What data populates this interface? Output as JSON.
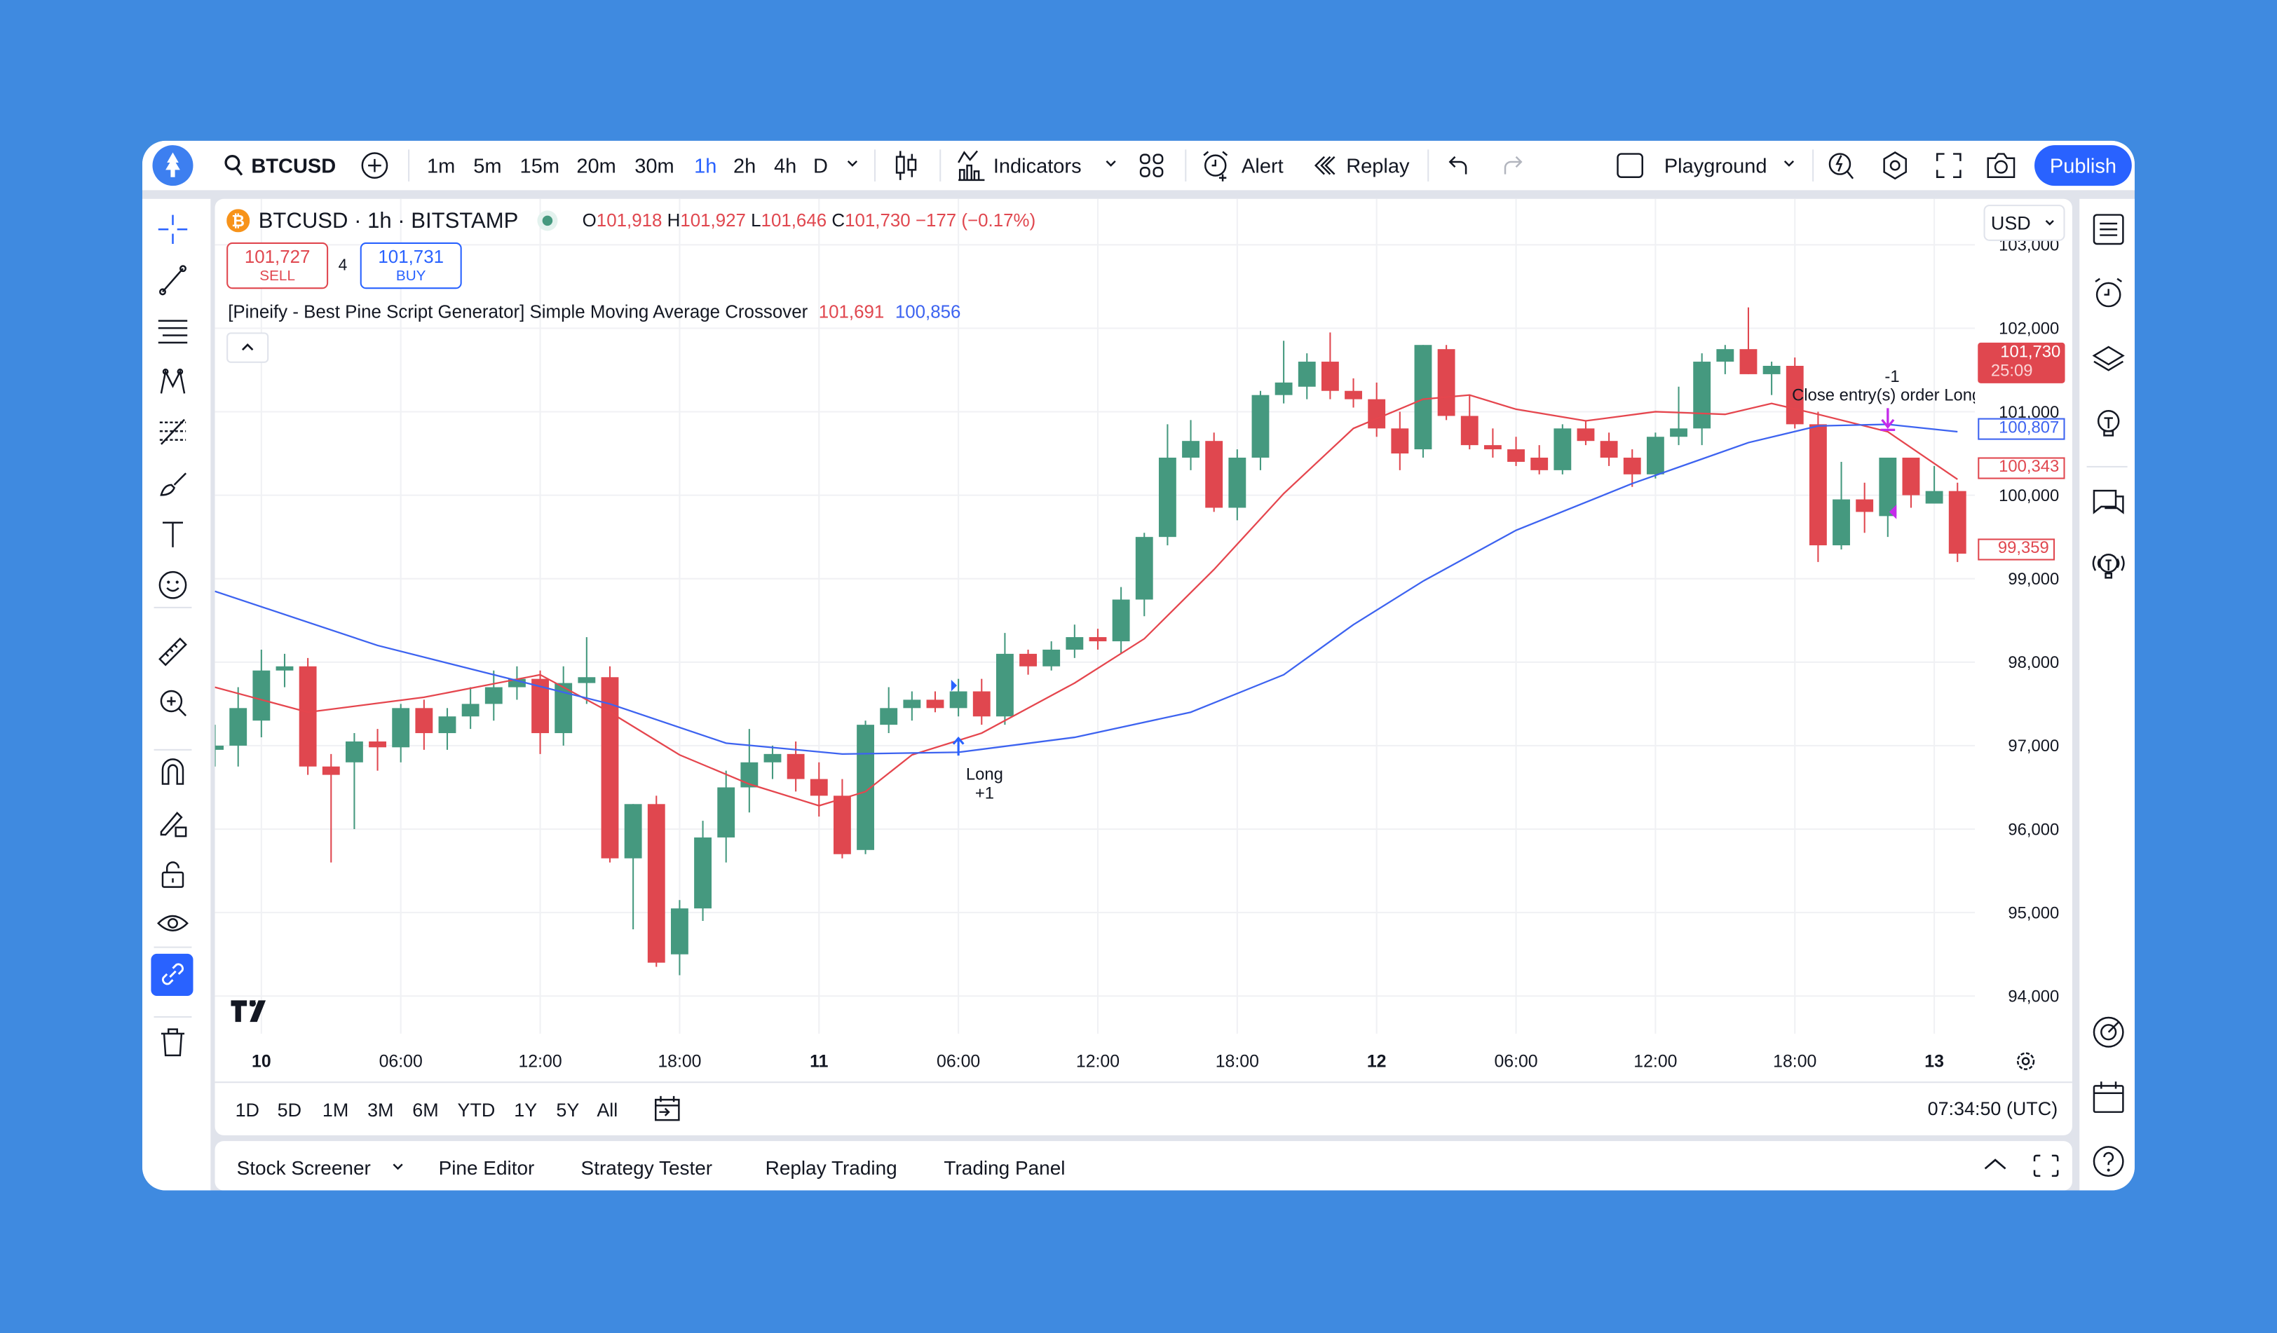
{
  "topbar": {
    "symbol": "BTCUSD",
    "intervals": [
      "1m",
      "5m",
      "15m",
      "20m",
      "30m",
      "1h",
      "2h",
      "4h",
      "D"
    ],
    "active_interval": "1h",
    "indicators_label": "Indicators",
    "alert_label": "Alert",
    "replay_label": "Replay",
    "layout_name": "Playground",
    "publish_label": "Publish",
    "accent_color": "#2962ff"
  },
  "legend": {
    "title": "BTCUSD · 1h · BITSTAMP",
    "o_label": "O",
    "o_value": "101,918",
    "h_label": "H",
    "h_value": "101,927",
    "l_label": "L",
    "l_value": "101,646",
    "c_label": "C",
    "c_value": "101,730",
    "change": "−177 (−0.17%)",
    "market_status": "open"
  },
  "trade": {
    "sell_price": "101,727",
    "sell_label": "SELL",
    "spread": "4",
    "buy_price": "101,731",
    "buy_label": "BUY"
  },
  "indicator": {
    "name": "[Pineify - Best Pine Script Generator] Simple Moving Average Crossover",
    "fast_value": "101,691",
    "slow_value": "100,856"
  },
  "price_axis": {
    "currency": "USD",
    "last_price": "101,730",
    "countdown": "25:09",
    "slow_sma_label": "100,807",
    "fast_sma_label": "100,343",
    "low_label": "99,359"
  },
  "time_axis_labels": [
    {
      "text": "10",
      "bold": true,
      "t": "10 00:00"
    },
    {
      "text": "06:00",
      "t": "10 06:00"
    },
    {
      "text": "12:00",
      "t": "10 12:00"
    },
    {
      "text": "18:00",
      "t": "10 18:00"
    },
    {
      "text": "11",
      "bold": true,
      "t": "11 00:00"
    },
    {
      "text": "06:00",
      "t": "11 06:00"
    },
    {
      "text": "12:00",
      "t": "11 12:00"
    },
    {
      "text": "18:00",
      "t": "11 18:00"
    },
    {
      "text": "12",
      "bold": true,
      "t": "12 00:00"
    },
    {
      "text": "06:00",
      "t": "12 06:00"
    },
    {
      "text": "12:00",
      "t": "12 12:00"
    },
    {
      "text": "18:00",
      "t": "12 18:00"
    },
    {
      "text": "13",
      "bold": true,
      "t": "13 00:00"
    }
  ],
  "ranges": [
    "1D",
    "5D",
    "1M",
    "3M",
    "6M",
    "YTD",
    "1Y",
    "5Y",
    "All"
  ],
  "clock": "07:34:50 (UTC)",
  "bottom_tabs": [
    "Stock Screener",
    "Pine Editor",
    "Strategy Tester",
    "Replay Trading",
    "Trading Panel"
  ],
  "markers": {
    "long_label": "Long",
    "long_qty": "+1",
    "long_t": "11 06:00",
    "long_price": 96950,
    "close_qty": "-1",
    "close_label": "Close entry(s) order Long",
    "close_t": "12 22:00",
    "close_price": 100800
  },
  "chart_data": {
    "type": "candlestick",
    "start": "9 22:00",
    "interval_hours": 1,
    "ylim": [
      93550,
      103550
    ],
    "yticks": [
      94000,
      95000,
      96000,
      97000,
      98000,
      99000,
      100000,
      101000,
      102000,
      103000
    ],
    "grid": true,
    "colors": {
      "up": "#45997f",
      "down": "#e0474f",
      "fast_sma": "#e5464e",
      "slow_sma": "#3d63f0",
      "marker": "#c42bea"
    },
    "candles": [
      [
        96950,
        97250,
        96750,
        97000
      ],
      [
        97000,
        97700,
        96750,
        97450
      ],
      [
        97300,
        98150,
        97100,
        97900
      ],
      [
        97900,
        98100,
        97700,
        97950
      ],
      [
        97950,
        98050,
        96650,
        96750
      ],
      [
        96750,
        96900,
        95600,
        96650
      ],
      [
        96800,
        97150,
        96000,
        97050
      ],
      [
        97050,
        97200,
        96700,
        96980
      ],
      [
        96980,
        97500,
        96800,
        97450
      ],
      [
        97450,
        97550,
        96950,
        97150
      ],
      [
        97150,
        97450,
        96950,
        97350
      ],
      [
        97350,
        97700,
        97200,
        97500
      ],
      [
        97500,
        97900,
        97300,
        97700
      ],
      [
        97700,
        97950,
        97550,
        97800
      ],
      [
        97800,
        97900,
        96900,
        97150
      ],
      [
        97150,
        97950,
        97000,
        97750
      ],
      [
        97750,
        98300,
        97500,
        97820
      ],
      [
        97820,
        97950,
        95600,
        95650
      ],
      [
        95650,
        96300,
        94800,
        96300
      ],
      [
        96300,
        96400,
        94350,
        94400
      ],
      [
        94500,
        95150,
        94250,
        95050
      ],
      [
        95050,
        96100,
        94900,
        95900
      ],
      [
        95900,
        96700,
        95600,
        96500
      ],
      [
        96500,
        97200,
        96200,
        96800
      ],
      [
        96800,
        97000,
        96600,
        96900
      ],
      [
        96900,
        97050,
        96450,
        96600
      ],
      [
        96600,
        96800,
        96150,
        96400
      ],
      [
        96400,
        96600,
        95650,
        95700
      ],
      [
        95750,
        97300,
        95700,
        97250
      ],
      [
        97250,
        97700,
        97150,
        97450
      ],
      [
        97450,
        97650,
        97300,
        97550
      ],
      [
        97550,
        97650,
        97400,
        97450
      ],
      [
        97450,
        97800,
        97350,
        97650
      ],
      [
        97650,
        97800,
        97250,
        97350
      ],
      [
        97350,
        98350,
        97250,
        98100
      ],
      [
        98100,
        98150,
        97850,
        97950
      ],
      [
        97950,
        98250,
        97900,
        98150
      ],
      [
        98150,
        98450,
        98050,
        98300
      ],
      [
        98300,
        98400,
        98150,
        98250
      ],
      [
        98250,
        98900,
        98100,
        98750
      ],
      [
        98750,
        99550,
        98550,
        99500
      ],
      [
        99500,
        100850,
        99400,
        100450
      ],
      [
        100450,
        100900,
        100300,
        100650
      ],
      [
        100650,
        100750,
        99800,
        99850
      ],
      [
        99850,
        100550,
        99700,
        100450
      ],
      [
        100450,
        101250,
        100300,
        101200
      ],
      [
        101200,
        101850,
        101100,
        101350
      ],
      [
        101300,
        101700,
        101150,
        101600
      ],
      [
        101600,
        101950,
        101150,
        101250
      ],
      [
        101250,
        101400,
        101050,
        101150
      ],
      [
        101150,
        101350,
        100700,
        100800
      ],
      [
        100800,
        101000,
        100300,
        100500
      ],
      [
        100550,
        101800,
        100450,
        101800
      ],
      [
        101750,
        101800,
        100900,
        100950
      ],
      [
        100950,
        101200,
        100550,
        100600
      ],
      [
        100600,
        100800,
        100450,
        100550
      ],
      [
        100550,
        100700,
        100350,
        100400
      ],
      [
        100450,
        100600,
        100250,
        100300
      ],
      [
        100300,
        100850,
        100250,
        100800
      ],
      [
        100800,
        100900,
        100600,
        100650
      ],
      [
        100650,
        100750,
        100350,
        100450
      ],
      [
        100450,
        100550,
        100100,
        100250
      ],
      [
        100250,
        100750,
        100200,
        100700
      ],
      [
        100700,
        101300,
        100600,
        100800
      ],
      [
        100800,
        101700,
        100600,
        101600
      ],
      [
        101600,
        101800,
        101450,
        101750
      ],
      [
        101750,
        102250,
        101450,
        101450
      ],
      [
        101450,
        101600,
        101200,
        101550
      ],
      [
        101550,
        101650,
        100800,
        100850
      ],
      [
        100850,
        101000,
        99200,
        99400
      ],
      [
        99400,
        100400,
        99350,
        99950
      ],
      [
        99950,
        100150,
        99550,
        99800
      ],
      [
        99750,
        100450,
        99500,
        100450
      ],
      [
        100450,
        100450,
        99850,
        100000
      ],
      [
        99900,
        100350,
        99900,
        100050
      ],
      [
        100050,
        100150,
        99200,
        99300
      ]
    ],
    "fast_sma": [
      [
        "9 22:00",
        97700
      ],
      [
        "10 02:00",
        97400
      ],
      [
        "10 07:00",
        97580
      ],
      [
        "10 12:00",
        97850
      ],
      [
        "10 15:00",
        97400
      ],
      [
        "10 18:00",
        96890
      ],
      [
        "10 21:00",
        96540
      ],
      [
        "11 00:00",
        96280
      ],
      [
        "11 02:00",
        96450
      ],
      [
        "11 04:00",
        96890
      ],
      [
        "11 07:00",
        97150
      ],
      [
        "11 11:00",
        97750
      ],
      [
        "11 14:00",
        98280
      ],
      [
        "11 17:00",
        99110
      ],
      [
        "11 20:00",
        100020
      ],
      [
        "11 23:00",
        100800
      ],
      [
        "12 02:00",
        101150
      ],
      [
        "12 04:00",
        101200
      ],
      [
        "12 06:00",
        101030
      ],
      [
        "12 09:00",
        100890
      ],
      [
        "12 12:00",
        101000
      ],
      [
        "12 15:00",
        100970
      ],
      [
        "12 17:00",
        101100
      ],
      [
        "12 19:00",
        100970
      ],
      [
        "12 22:00",
        100760
      ],
      [
        "13 01:00",
        100190
      ]
    ],
    "slow_sma": [
      [
        "9 22:00",
        98850
      ],
      [
        "10 05:00",
        98200
      ],
      [
        "10 10:00",
        97850
      ],
      [
        "10 15:00",
        97500
      ],
      [
        "10 20:00",
        97030
      ],
      [
        "11 01:00",
        96900
      ],
      [
        "11 06:00",
        96920
      ],
      [
        "11 11:00",
        97100
      ],
      [
        "11 16:00",
        97400
      ],
      [
        "11 20:00",
        97850
      ],
      [
        "11 23:00",
        98450
      ],
      [
        "12 02:00",
        98970
      ],
      [
        "12 06:00",
        99580
      ],
      [
        "12 11:00",
        100140
      ],
      [
        "12 16:00",
        100630
      ],
      [
        "12 19:00",
        100830
      ],
      [
        "12 22:00",
        100850
      ],
      [
        "13 01:00",
        100760
      ]
    ]
  }
}
